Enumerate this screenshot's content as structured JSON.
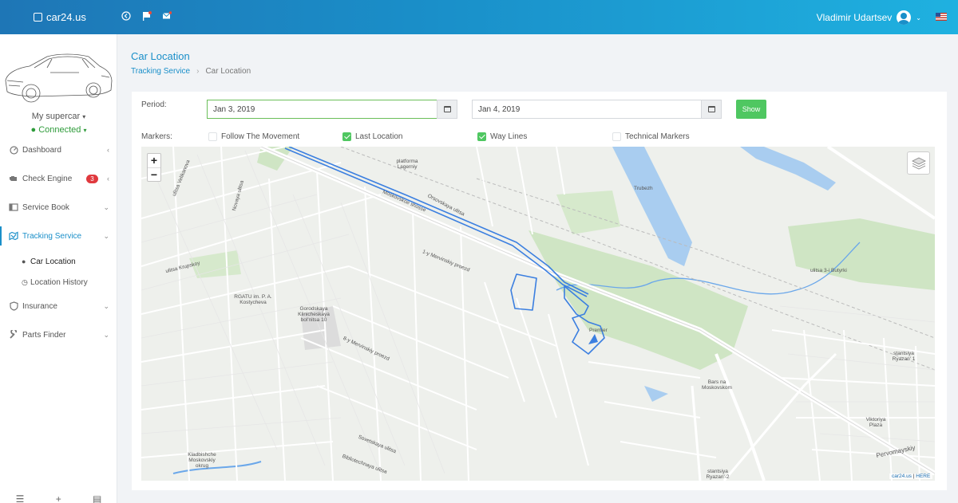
{
  "header": {
    "brand": "car24.us",
    "user_name": "Vladimir Udartsev",
    "icons": [
      "grid-logo-icon",
      "back-circle-icon",
      "flag-icon",
      "mail-icon",
      "chevron-down-icon",
      "us-flag-icon"
    ]
  },
  "sidebar": {
    "car_name": "My supercar",
    "car_status": "Connected",
    "items": [
      {
        "label": "Dashboard",
        "icon": "gauge-icon"
      },
      {
        "label": "Check Engine",
        "icon": "engine-icon",
        "badge": "3"
      },
      {
        "label": "Service Book",
        "icon": "book-icon"
      },
      {
        "label": "Tracking Service",
        "icon": "map-icon"
      },
      {
        "label": "Insurance",
        "icon": "shield-icon"
      },
      {
        "label": "Parts Finder",
        "icon": "wrench-icon"
      }
    ],
    "subitems": [
      {
        "label": "Car Location",
        "icon": "pin-icon"
      },
      {
        "label": "Location History",
        "icon": "history-icon"
      }
    ]
  },
  "page": {
    "title": "Car Location",
    "breadcrumb": {
      "parent": "Tracking Service",
      "current": "Car Location"
    }
  },
  "filters": {
    "period_label": "Period:",
    "date_from": "Jan 3, 2019",
    "date_to": "Jan 4, 2019",
    "show_label": "Show",
    "markers_label": "Markers:",
    "markers": [
      {
        "label": "Follow The Movement",
        "checked": false
      },
      {
        "label": "Last Location",
        "checked": true
      },
      {
        "label": "Way Lines",
        "checked": true
      },
      {
        "label": "Technical Markers",
        "checked": false
      }
    ]
  },
  "map": {
    "zoom_in": "+",
    "zoom_out": "−",
    "attribution_site": "car24.us",
    "attribution_sep": " | ",
    "attribution_provider": "HERE",
    "route_color": "#3b7fe0",
    "labels": [
      "ulitsa Velikanova",
      "Novaya ulitsa",
      "platforma Lagerniy",
      "Moskovskoe shosse",
      "Orsovskaya ulitsa",
      "ulitsa Krupskoy",
      "RGATU im. P. A. Kostycheva",
      "Gorodskaya Klinicheskaya bol'nitsa 10",
      "1-y Mervinskiy proezd",
      "8-y Mervinskiy proezd",
      "Trubezh",
      "Premier",
      "Bars na Moskovskom",
      "ulitsa 3-i Butyrki",
      "stantsiya Ryazan' 1",
      "Viktoriya Plaza",
      "Pervomayskiy",
      "Kladbishche Moskovskiy okrug",
      "Sovetskaya ulitsa",
      "Bibliotechnaya ulitsa",
      "stantsiya Ryazan'-2"
    ]
  }
}
